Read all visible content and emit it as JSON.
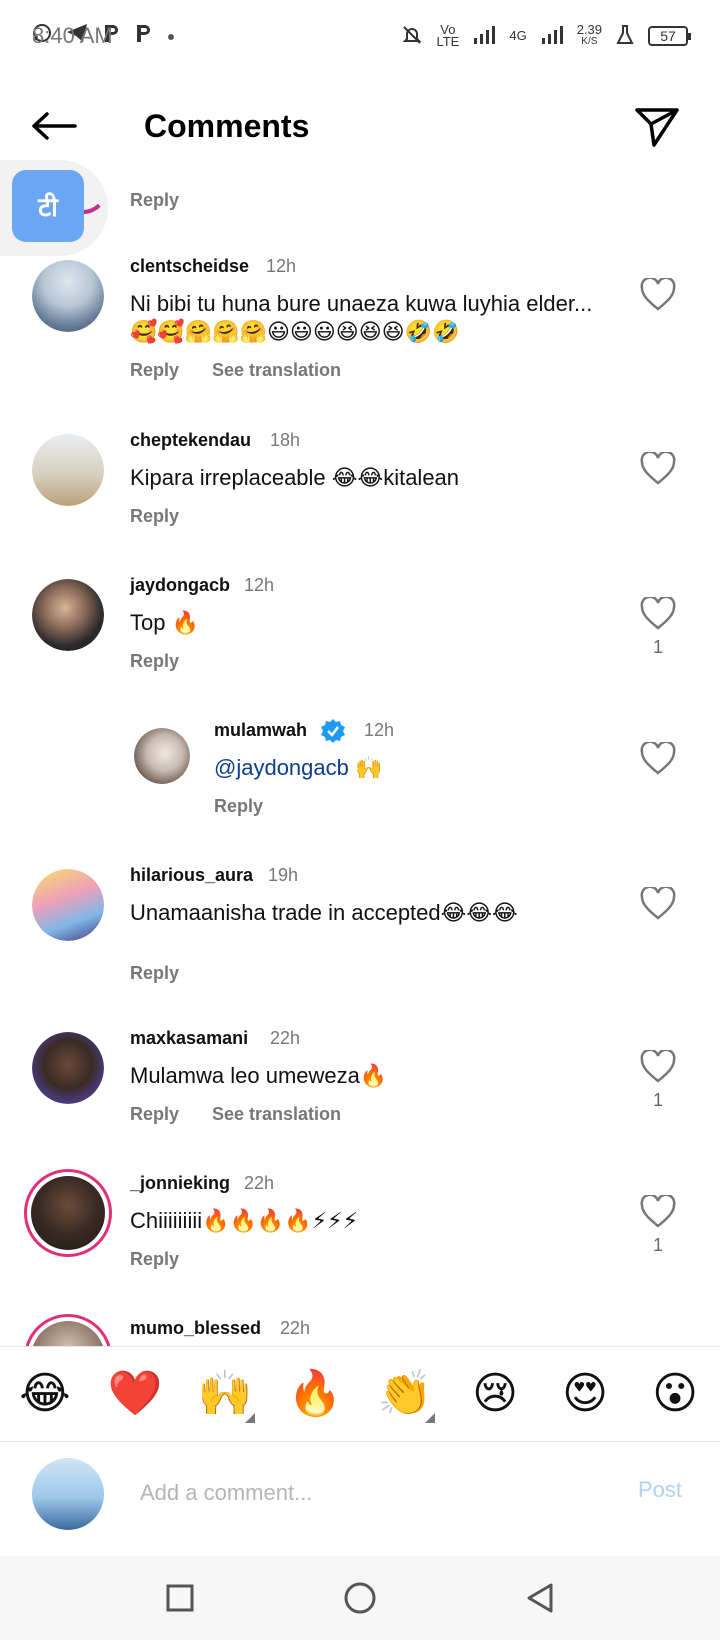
{
  "status_bar": {
    "time": "8:40 AM",
    "network_vo": "Vo",
    "network_lte": "LTE",
    "network_4g": "4G",
    "speed_value": "2.39",
    "speed_unit": "K/S",
    "battery": "57"
  },
  "header": {
    "title": "Comments"
  },
  "bubble": {
    "label": "टी"
  },
  "labels": {
    "reply": "Reply",
    "see_translation": "See translation"
  },
  "comments": [
    {
      "username": "clentscheidse",
      "time": "12h",
      "text": "Ni bibi tu huna bure unaeza kuwa luyhia elder...🥰🥰🤗🤗🤗😃😃😃😆😆😆🤣🤣",
      "likes": ""
    },
    {
      "username": "cheptekendau",
      "time": "18h",
      "text": "Kipara irreplaceable 😂😂kitalean",
      "likes": ""
    },
    {
      "username": "jaydongacb",
      "time": "12h",
      "text": "Top 🔥",
      "likes": "1"
    },
    {
      "username": "mulamwah",
      "time": "12h",
      "mention": "@jaydongacb",
      "text": " 🙌",
      "likes": ""
    },
    {
      "username": "hilarious_aura",
      "time": "19h",
      "text": "Unamaanisha trade in accepted😂😂😂",
      "likes": ""
    },
    {
      "username": "maxkasamani",
      "time": "22h",
      "text": "Mulamwa leo umeweza🔥",
      "likes": "1"
    },
    {
      "username": "_jonnieking",
      "time": "22h",
      "text": "Chiiiiiiiii🔥🔥🔥🔥⚡⚡⚡",
      "likes": "1"
    },
    {
      "username": "mumo_blessed",
      "time": "22h",
      "text": "",
      "likes": ""
    }
  ],
  "emoji_bar": [
    "😂",
    "❤️",
    "🙌",
    "🔥",
    "👏",
    "😢",
    "😍",
    "😮"
  ],
  "input": {
    "placeholder": "Add a comment...",
    "post_label": "Post"
  },
  "colors": {
    "accent_post": "#aed3f5",
    "mention": "#0b3d91",
    "verified": "#1d9bf0",
    "story_ring": "#e0307a"
  }
}
